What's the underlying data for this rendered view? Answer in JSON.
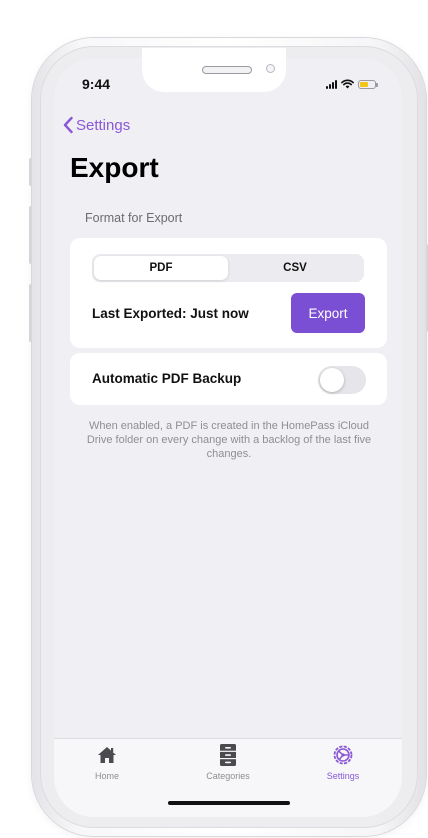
{
  "status_bar": {
    "time": "9:44",
    "icons": [
      "signal-icon",
      "wifi-icon",
      "battery-icon"
    ]
  },
  "nav": {
    "back_label": "Settings",
    "title": "Export"
  },
  "section": {
    "header": "Format for Export"
  },
  "format_selector": {
    "options": [
      "PDF",
      "CSV"
    ],
    "selected": "PDF"
  },
  "export_row": {
    "last_exported": "Last Exported: Just now",
    "button_label": "Export"
  },
  "backup_row": {
    "label": "Automatic PDF Backup",
    "enabled": false
  },
  "footer_note": "When enabled, a PDF is created in the HomePass iCloud Drive folder on every change with a backlog of the last five changes.",
  "tab_bar": {
    "items": [
      {
        "label": "Home",
        "icon": "home-icon",
        "active": false
      },
      {
        "label": "Categories",
        "icon": "cabinet-icon",
        "active": false
      },
      {
        "label": "Settings",
        "icon": "gear-icon",
        "active": true
      }
    ]
  },
  "colors": {
    "accent": "#7b4fd3",
    "tint": "#8a58d6",
    "background": "#efeff4",
    "battery": "#f5c518"
  }
}
